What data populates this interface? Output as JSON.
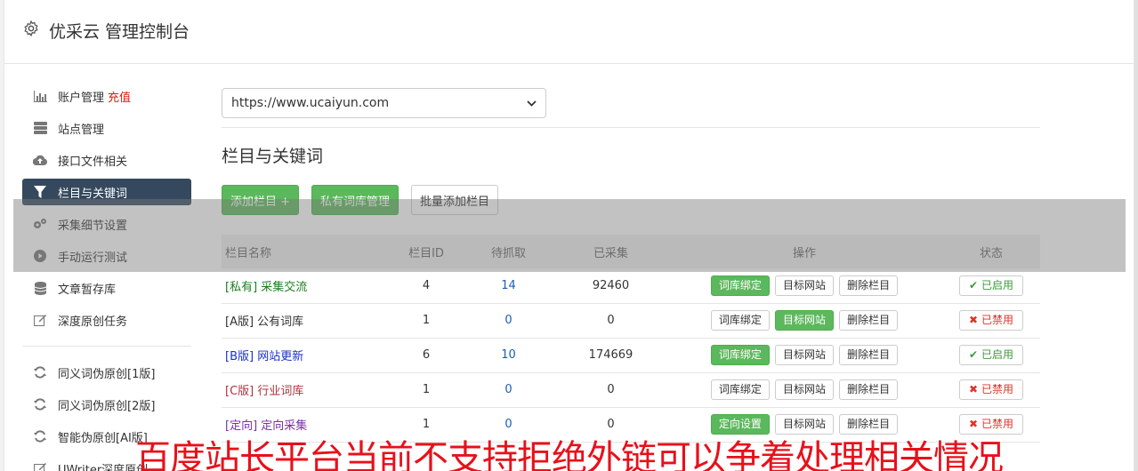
{
  "header": {
    "title": "优采云 管理控制台",
    "icon": "gear-icon"
  },
  "sidebar": {
    "items": [
      {
        "label": "账户管理",
        "extra": "充值",
        "icon": "bar-chart-icon"
      },
      {
        "label": "站点管理",
        "icon": "server-icon"
      },
      {
        "label": "接口文件相关",
        "icon": "cloud-upload-icon"
      },
      {
        "label": "栏目与关键词",
        "icon": "filter-icon",
        "active": true
      },
      {
        "label": "采集细节设置",
        "icon": "cogs-icon"
      },
      {
        "label": "手动运行测试",
        "icon": "play-icon"
      },
      {
        "label": "文章暂存库",
        "icon": "database-icon"
      },
      {
        "label": "深度原创任务",
        "icon": "edit-icon"
      }
    ],
    "items2": [
      {
        "label": "同义词伪原创[1版]",
        "icon": "refresh-icon"
      },
      {
        "label": "同义词伪原创[2版]",
        "icon": "refresh-icon"
      },
      {
        "label": "智能伪原创[AI版]",
        "icon": "refresh-icon"
      },
      {
        "label": "UWriter深度原创",
        "icon": "edit-icon"
      }
    ]
  },
  "main": {
    "site_select": "https://www.ucaiyun.com",
    "section_title": "栏目与关键词",
    "buttons": {
      "add": "添加栏目 +",
      "private_lib": "私有词库管理",
      "batch_add": "批量添加栏目"
    },
    "table": {
      "headers": [
        "栏目名称",
        "栏目ID",
        "待抓取",
        "已采集",
        "操作",
        "状态"
      ],
      "rows": [
        {
          "name": "[私有] 采集交流",
          "id": "4",
          "pending": "14",
          "collected": "92460",
          "op1": "词库绑定",
          "op2": "目标网站",
          "op3": "删除栏目",
          "status": "已启用"
        },
        {
          "name": "[A版] 公有词库",
          "id": "1",
          "pending": "0",
          "collected": "0",
          "op1": "词库绑定",
          "op2": "目标网站",
          "op3": "删除栏目",
          "status": "已禁用"
        },
        {
          "name": "[B版] 网站更新",
          "id": "6",
          "pending": "10",
          "collected": "174669",
          "op1": "词库绑定",
          "op2": "目标网站",
          "op3": "删除栏目",
          "status": "已启用"
        },
        {
          "name": "[C版] 行业词库",
          "id": "1",
          "pending": "0",
          "collected": "0",
          "op1": "词库绑定",
          "op2": "目标网站",
          "op3": "删除栏目",
          "status": "已禁用"
        },
        {
          "name": "[定向] 定向采集",
          "id": "1",
          "pending": "0",
          "collected": "0",
          "op1": "定向设置",
          "op2": "目标网站",
          "op3": "删除栏目",
          "status": "已禁用"
        }
      ]
    }
  },
  "banner": "百度站长平台当前不支持拒绝外链可以争着处理相关情况",
  "colors": {
    "accent_green": "#5cb85c",
    "sidebar_active": "#34495e",
    "banner_red": "#e8101a"
  }
}
